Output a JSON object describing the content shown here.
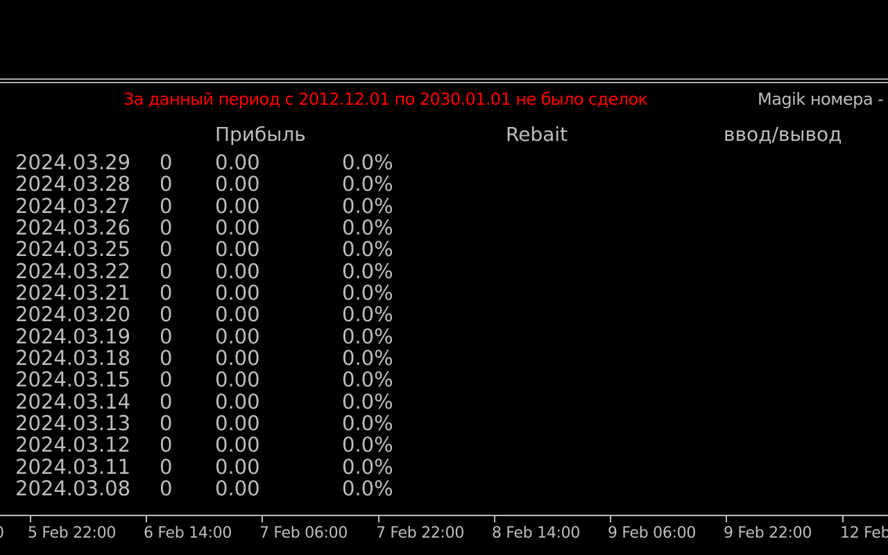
{
  "colors": {
    "background": "#000000",
    "text": "#bdbdbd",
    "notice": "#ff0000",
    "separator": "#a9a9a9"
  },
  "notice": "За данный период с 2012.12.01 по 2030.01.01 не было сделок",
  "magik_label": "Magik номера -",
  "headers": {
    "profit": "Прибыль",
    "rebait": "Rebait",
    "io": "ввод/вывод"
  },
  "rows": [
    {
      "date": "2024.03.29",
      "count": "0",
      "profit": "0.00",
      "pct": "0.0%"
    },
    {
      "date": "2024.03.28",
      "count": "0",
      "profit": "0.00",
      "pct": "0.0%"
    },
    {
      "date": "2024.03.27",
      "count": "0",
      "profit": "0.00",
      "pct": "0.0%"
    },
    {
      "date": "2024.03.26",
      "count": "0",
      "profit": "0.00",
      "pct": "0.0%"
    },
    {
      "date": "2024.03.25",
      "count": "0",
      "profit": "0.00",
      "pct": "0.0%"
    },
    {
      "date": "2024.03.22",
      "count": "0",
      "profit": "0.00",
      "pct": "0.0%"
    },
    {
      "date": "2024.03.21",
      "count": "0",
      "profit": "0.00",
      "pct": "0.0%"
    },
    {
      "date": "2024.03.20",
      "count": "0",
      "profit": "0.00",
      "pct": "0.0%"
    },
    {
      "date": "2024.03.19",
      "count": "0",
      "profit": "0.00",
      "pct": "0.0%"
    },
    {
      "date": "2024.03.18",
      "count": "0",
      "profit": "0.00",
      "pct": "0.0%"
    },
    {
      "date": "2024.03.15",
      "count": "0",
      "profit": "0.00",
      "pct": "0.0%"
    },
    {
      "date": "2024.03.14",
      "count": "0",
      "profit": "0.00",
      "pct": "0.0%"
    },
    {
      "date": "2024.03.13",
      "count": "0",
      "profit": "0.00",
      "pct": "0.0%"
    },
    {
      "date": "2024.03.12",
      "count": "0",
      "profit": "0.00",
      "pct": "0.0%"
    },
    {
      "date": "2024.03.11",
      "count": "0",
      "profit": "0.00",
      "pct": "0.0%"
    },
    {
      "date": "2024.03.08",
      "count": "0",
      "profit": "0.00",
      "pct": "0.0%"
    }
  ],
  "time_axis": {
    "labels": [
      "0",
      "5 Feb 22:00",
      "6 Feb 14:00",
      "7 Feb 06:00",
      "7 Feb 22:00",
      "8 Feb 14:00",
      "9 Feb 06:00",
      "9 Feb 22:00",
      "12 Feb"
    ]
  }
}
